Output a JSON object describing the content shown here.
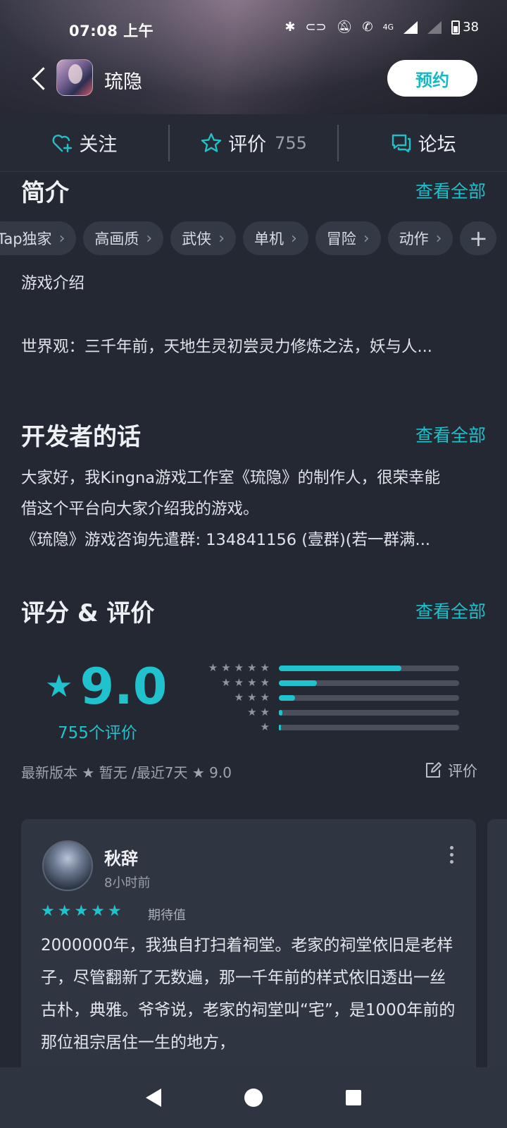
{
  "status_bar": {
    "time": "07:08 上午",
    "network": "4G",
    "battery": "38"
  },
  "header": {
    "app_title": "琉隐",
    "reserve_label": "预约"
  },
  "actions": {
    "follow_label": "关注",
    "review_label": "评价",
    "review_count": "755",
    "forum_label": "论坛"
  },
  "intro": {
    "title": "简介",
    "see_all": "查看全部",
    "tags": [
      "Tap独家",
      "高画质",
      "武侠",
      "单机",
      "冒险",
      "动作"
    ],
    "heading": "游戏介绍",
    "summary": "世界观：三千年前，天地生灵初尝灵力修炼之法，妖与人..."
  },
  "developer": {
    "title": "开发者的话",
    "see_all": "查看全部",
    "line1": "大家好，我Kingna游戏工作室《琉隐》的制作人，很荣幸能",
    "line2": "借这个平台向大家介绍我的游戏。",
    "line3": "《琉隐》游戏咨询先遣群: 134841156 (壹群)(若一群满..."
  },
  "ratings": {
    "title": "评分 & 评价",
    "see_all": "查看全部",
    "score": "9.0",
    "count_label": "755个评价",
    "distribution": [
      {
        "stars": 5,
        "fraction": 0.68
      },
      {
        "stars": 4,
        "fraction": 0.21
      },
      {
        "stars": 3,
        "fraction": 0.09
      },
      {
        "stars": 2,
        "fraction": 0.02
      },
      {
        "stars": 1,
        "fraction": 0.01
      }
    ],
    "latest_version_label": "最新版本",
    "latest_version_value": "暂无",
    "recent_label": "/最近7天",
    "recent_value": "9.0",
    "rate_label": "评价"
  },
  "review": {
    "author": "秋辞",
    "time": "8小时前",
    "stars": 5,
    "tag": "期待值",
    "body": "2000000年，我独自打扫着祠堂。老家的祠堂依旧是老样子，尽管翻新了无数遍，那一千年前的样式依旧透出一丝古朴，典雅。爷爷说，老家的祠堂叫“宅”，是1000年前的那位祖宗居住一生的地方，"
  },
  "colors": {
    "accent": "#20c3cd",
    "background": "#242833",
    "card": "#303542"
  }
}
